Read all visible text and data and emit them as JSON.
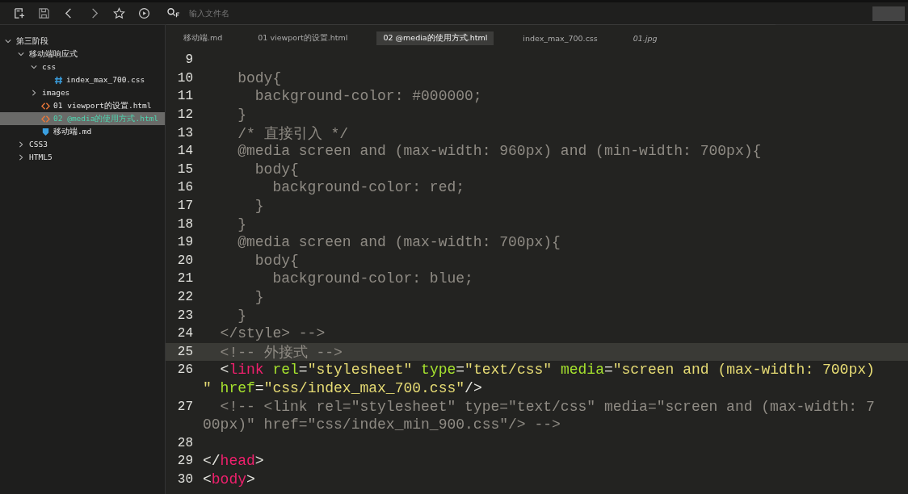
{
  "toolbar": {
    "search": {
      "placeholder": "输入文件名"
    }
  },
  "sidebar": {
    "tree": [
      {
        "label": "第三阶段",
        "kind": "folder",
        "expanded": true,
        "selected": false,
        "children": [
          {
            "label": "移动端响应式",
            "kind": "folder",
            "expanded": true,
            "selected": false,
            "children": [
              {
                "label": "css",
                "kind": "folder",
                "expanded": true,
                "selected": false,
                "children": [
                  {
                    "label": "index_max_700.css",
                    "kind": "css",
                    "selected": false
                  }
                ]
              },
              {
                "label": "images",
                "kind": "folder",
                "expanded": false,
                "selected": false
              },
              {
                "label": "01 viewport的设置.html",
                "kind": "html",
                "selected": false
              },
              {
                "label": "02 @media的使用方式.html",
                "kind": "html",
                "selected": true
              },
              {
                "label": "移动端.md",
                "kind": "md",
                "selected": false
              }
            ]
          },
          {
            "label": "CSS3",
            "kind": "folder",
            "expanded": false,
            "selected": false
          },
          {
            "label": "HTML5",
            "kind": "folder",
            "expanded": false,
            "selected": false
          }
        ]
      }
    ]
  },
  "tabs": [
    {
      "label": "移动端.md",
      "selected": false,
      "italic": false
    },
    {
      "label": "01 viewport的设置.html",
      "selected": false,
      "italic": false
    },
    {
      "label": "02 @media的使用方式.html",
      "selected": true,
      "italic": false
    },
    {
      "label": "index_max_700.css",
      "selected": false,
      "italic": false
    },
    {
      "label": "01.jpg",
      "selected": false,
      "italic": true
    }
  ],
  "editor": {
    "lines": [
      {
        "number": "9",
        "highlighted": false
      },
      {
        "number": "10",
        "highlighted": false,
        "wrapped_parts": [
          {
            "tokens": [
              {
                "kind": "c",
                "text": "    body{"
              }
            ]
          }
        ]
      },
      {
        "number": "11",
        "highlighted": false,
        "wrapped_parts": [
          {
            "tokens": [
              {
                "kind": "c",
                "text": "      background-color: #000000;"
              }
            ]
          }
        ]
      },
      {
        "number": "12",
        "highlighted": false,
        "wrapped_parts": [
          {
            "tokens": [
              {
                "kind": "c",
                "text": "    }"
              }
            ]
          }
        ]
      },
      {
        "number": "13",
        "highlighted": false,
        "wrapped_parts": [
          {
            "tokens": [
              {
                "kind": "c",
                "text": "    /* 直接引入 */"
              }
            ]
          }
        ]
      },
      {
        "number": "14",
        "highlighted": false,
        "wrapped_parts": [
          {
            "tokens": [
              {
                "kind": "c",
                "text": "    @media screen and (max-width: 960px) and (min-width: 700px){"
              }
            ]
          }
        ]
      },
      {
        "number": "15",
        "highlighted": false,
        "wrapped_parts": [
          {
            "tokens": [
              {
                "kind": "c",
                "text": "      body{"
              }
            ]
          }
        ]
      },
      {
        "number": "16",
        "highlighted": false,
        "wrapped_parts": [
          {
            "tokens": [
              {
                "kind": "c",
                "text": "        background-color: red;"
              }
            ]
          }
        ]
      },
      {
        "number": "17",
        "highlighted": false,
        "wrapped_parts": [
          {
            "tokens": [
              {
                "kind": "c",
                "text": "      }"
              }
            ]
          }
        ]
      },
      {
        "number": "18",
        "highlighted": false,
        "wrapped_parts": [
          {
            "tokens": [
              {
                "kind": "c",
                "text": "    }"
              }
            ]
          }
        ]
      },
      {
        "number": "19",
        "highlighted": false,
        "wrapped_parts": [
          {
            "tokens": [
              {
                "kind": "c",
                "text": "    @media screen and (max-width: 700px){"
              }
            ]
          }
        ]
      },
      {
        "number": "20",
        "highlighted": false,
        "wrapped_parts": [
          {
            "tokens": [
              {
                "kind": "c",
                "text": "      body{"
              }
            ]
          }
        ]
      },
      {
        "number": "21",
        "highlighted": false,
        "wrapped_parts": [
          {
            "tokens": [
              {
                "kind": "c",
                "text": "        background-color: blue;"
              }
            ]
          }
        ]
      },
      {
        "number": "22",
        "highlighted": false,
        "wrapped_parts": [
          {
            "tokens": [
              {
                "kind": "c",
                "text": "      }"
              }
            ]
          }
        ]
      },
      {
        "number": "23",
        "highlighted": false,
        "wrapped_parts": [
          {
            "tokens": [
              {
                "kind": "c",
                "text": "    }"
              }
            ]
          }
        ]
      },
      {
        "number": "24",
        "highlighted": false,
        "wrapped_parts": [
          {
            "tokens": [
              {
                "kind": "c",
                "text": "  </style> -->"
              }
            ]
          }
        ]
      },
      {
        "number": "25",
        "highlighted": true,
        "wrapped_parts": [
          {
            "tokens": [
              {
                "kind": "c",
                "text": "  <!-- 外接式 -->"
              }
            ]
          }
        ]
      },
      {
        "number": "26",
        "highlighted": false,
        "wrapped_parts": [
          {
            "tokens": [
              {
                "kind": "p",
                "text": "  <"
              },
              {
                "kind": "t",
                "text": "link"
              },
              {
                "kind": "a",
                "text": " rel"
              },
              {
                "kind": "p",
                "text": "="
              },
              {
                "kind": "s",
                "text": "\"stylesheet\""
              },
              {
                "kind": "a",
                "text": " type"
              },
              {
                "kind": "p",
                "text": "="
              },
              {
                "kind": "s",
                "text": "\"text/css\""
              },
              {
                "kind": "a",
                "text": " media"
              },
              {
                "kind": "p",
                "text": "="
              },
              {
                "kind": "s",
                "text": "\"screen and (max-width: 700px)"
              }
            ]
          },
          {
            "tokens": [
              {
                "kind": "s",
                "text": "\""
              },
              {
                "kind": "a",
                "text": " href"
              },
              {
                "kind": "p",
                "text": "="
              },
              {
                "kind": "s",
                "text": "\"css/index_max_700.css\""
              },
              {
                "kind": "p",
                "text": "/>"
              }
            ]
          }
        ]
      },
      {
        "number": "27",
        "highlighted": false,
        "wrapped_parts": [
          {
            "tokens": [
              {
                "kind": "c",
                "text": "  <!-- <link rel=\"stylesheet\" type=\"text/css\" media=\"screen and (max-width: 7"
              }
            ]
          },
          {
            "tokens": [
              {
                "kind": "c",
                "text": "00px)\" href=\"css/index_min_900.css\"/> -->"
              }
            ]
          }
        ]
      },
      {
        "number": "28",
        "highlighted": false
      },
      {
        "number": "29",
        "highlighted": false,
        "wrapped_parts": [
          {
            "tokens": [
              {
                "kind": "p",
                "text": "</"
              },
              {
                "kind": "t",
                "text": "head"
              },
              {
                "kind": "p",
                "text": ">"
              }
            ]
          }
        ]
      },
      {
        "number": "30",
        "highlighted": false,
        "wrapped_parts": [
          {
            "tokens": [
              {
                "kind": "p",
                "text": "<"
              },
              {
                "kind": "t",
                "text": "body"
              },
              {
                "kind": "p",
                "text": ">"
              }
            ]
          }
        ]
      }
    ]
  }
}
